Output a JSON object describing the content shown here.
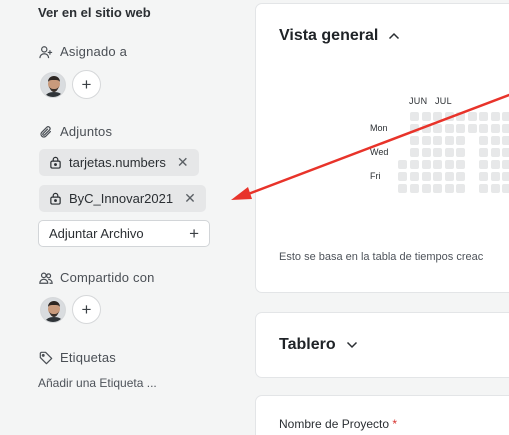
{
  "sidebar": {
    "view_site": "Ver en el sitio web",
    "assigned": {
      "title": "Asignado a",
      "icon": "user-plus-icon"
    },
    "attachments": {
      "title": "Adjuntos",
      "icon": "paperclip-icon",
      "files": [
        {
          "name": "tarjetas.numbers"
        },
        {
          "name": "ByC_Innovar2021"
        }
      ],
      "attach_label": "Adjuntar Archivo"
    },
    "shared": {
      "title": "Compartido con",
      "icon": "users-icon"
    },
    "tags": {
      "title": "Etiquetas",
      "icon": "tag-icon",
      "add_label": "Añadir una Etiqueta ..."
    }
  },
  "overview": {
    "title": "Vista general",
    "months": [
      "JUN",
      "JUL"
    ],
    "days": [
      "Mon",
      "Wed",
      "Fri"
    ],
    "note": "Esto se basa en la tabla de tiempos creac"
  },
  "board": {
    "title": "Tablero"
  },
  "project": {
    "name_label": "Nombre de Proyecto",
    "required_mark": "*"
  },
  "colors": {
    "arrow": "#e8332a",
    "sidebar_bg": "#f4f5f5",
    "card_bg": "#ffffff"
  }
}
